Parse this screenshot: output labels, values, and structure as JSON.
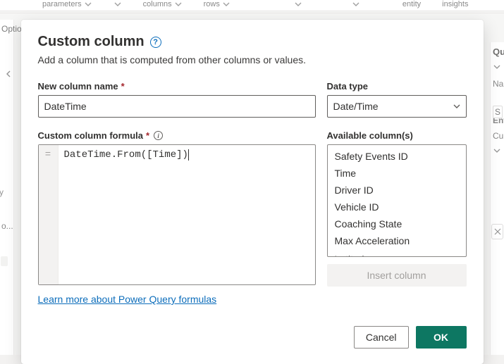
{
  "background": {
    "ribbon": [
      "parameters",
      "columns",
      "rows",
      "entity",
      "insights"
    ],
    "left_labels": {
      "options": "Optio",
      "y_suffix": "y",
      "o_suffix": "o..."
    },
    "right_panel": {
      "header": "Qu",
      "na": "Na",
      "s": "S",
      "ent": "Ent",
      "cu": "Cu"
    }
  },
  "dialog": {
    "title": "Custom column",
    "description": "Add a column that is computed from other columns or values.",
    "name_label": "New column name",
    "name_value": "DateTime",
    "type_label": "Data type",
    "type_value": "Date/Time",
    "formula_label": "Custom column formula",
    "formula_value": "DateTime.From([Time])",
    "gutter_symbol": "=",
    "available_label": "Available column(s)",
    "available_columns": [
      "Safety Events ID",
      "Time",
      "Driver ID",
      "Vehicle ID",
      "Coaching State",
      "Max Acceleration",
      "Latitude"
    ],
    "insert_label": "Insert column",
    "learn_link": "Learn more about Power Query formulas",
    "cancel_label": "Cancel",
    "ok_label": "OK"
  }
}
